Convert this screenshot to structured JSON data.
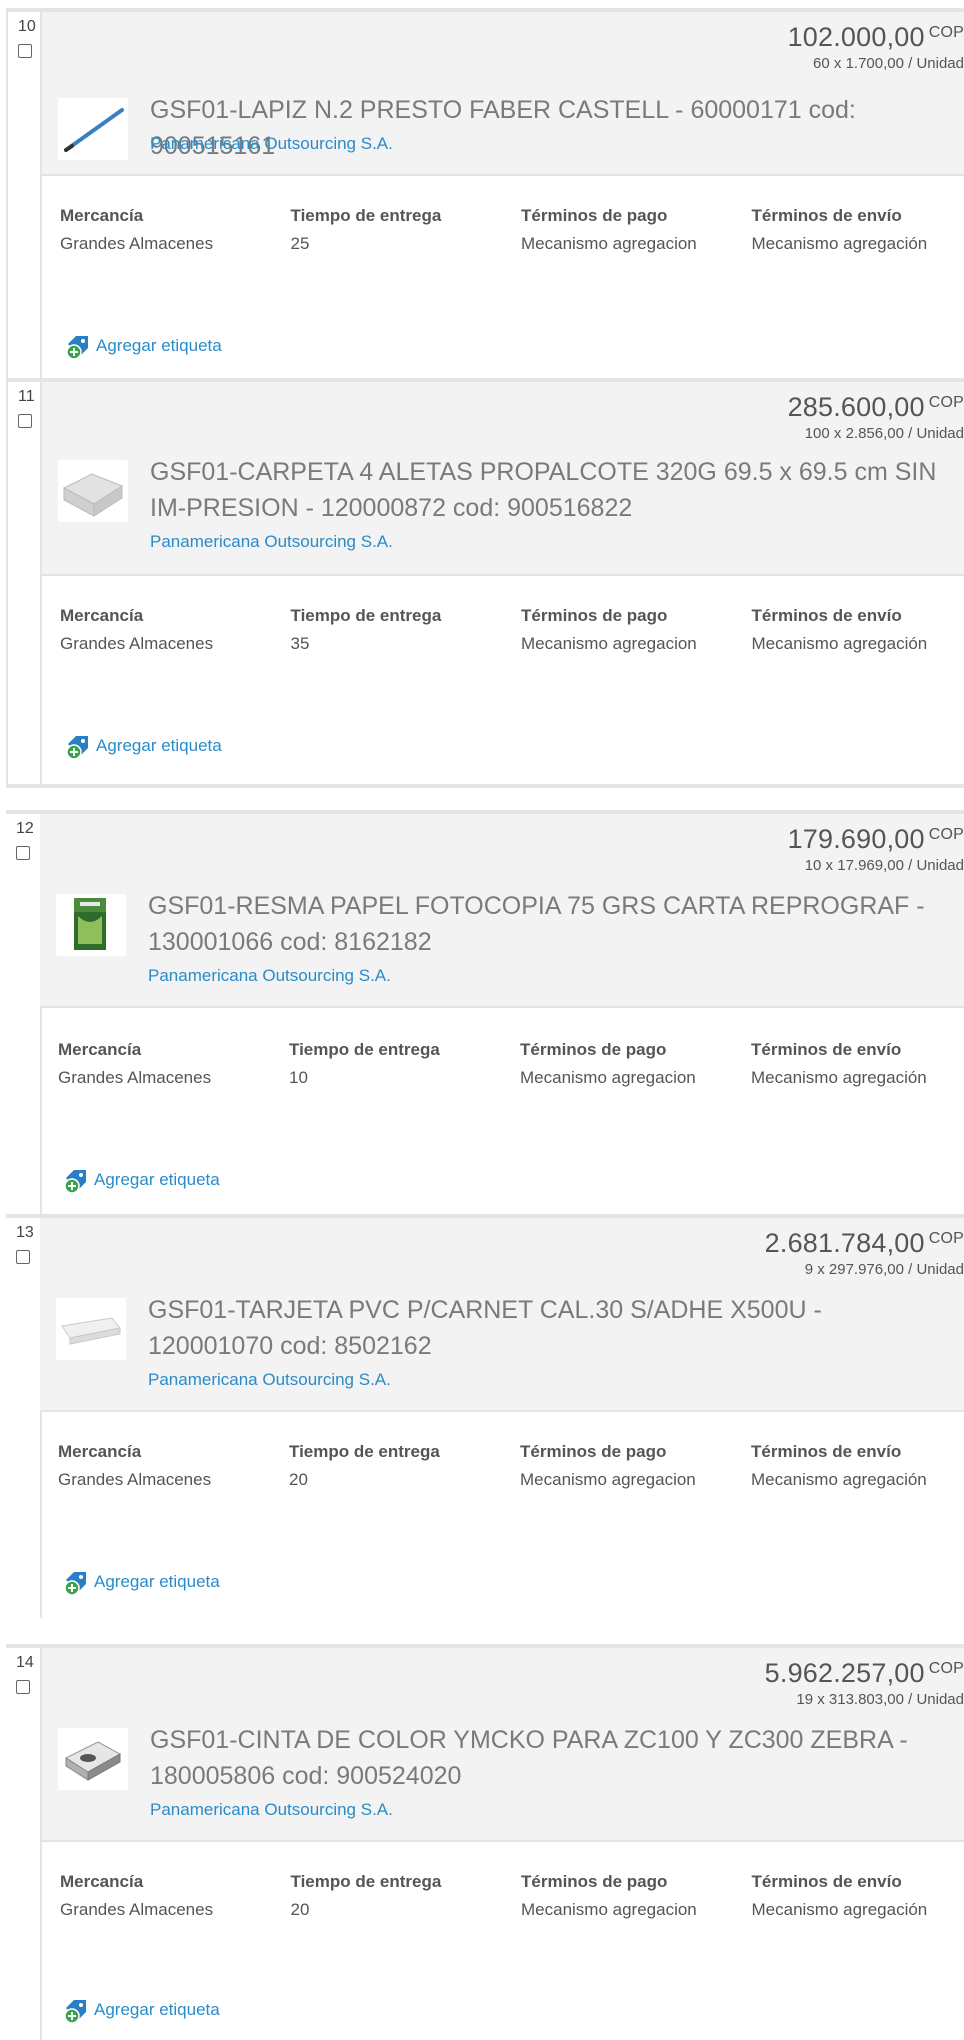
{
  "labels": {
    "merchandise": "Mercancía",
    "delivery": "Tiempo de entrega",
    "payment": "Términos de pago",
    "shipping": "Términos de envío",
    "add_tag": "Agregar etiqueta"
  },
  "items": [
    {
      "index": "10",
      "price": "102.000,00",
      "currency": "COP",
      "unit_line": "60 x 1.700,00 / Unidad",
      "title": "GSF01-LAPIZ N.2 PRESTO FABER CASTELL - 60000171 cod: 900515161",
      "vendor": "Panamericana Outsourcing S.A.",
      "merchandise": "Grandes Almacenes",
      "delivery": "25",
      "payment": "Mecanismo agregacion",
      "shipping": "Mecanismo agregación",
      "icon": "pencil-icon"
    },
    {
      "index": "11",
      "price": "285.600,00",
      "currency": "COP",
      "unit_line": "100 x 2.856,00 / Unidad",
      "title": "GSF01-CARPETA 4 ALETAS PROPALCOTE 320G 69.5 x 69.5 cm SIN IM-PRESION - 120000872 cod: 900516822",
      "vendor": "Panamericana Outsourcing S.A.",
      "merchandise": "Grandes Almacenes",
      "delivery": "35",
      "payment": "Mecanismo agregacion",
      "shipping": "Mecanismo agregación",
      "icon": "folder-icon"
    },
    {
      "index": "12",
      "price": "179.690,00",
      "currency": "COP",
      "unit_line": "10 x 17.969,00 / Unidad",
      "title": "GSF01-RESMA PAPEL FOTOCOPIA 75 GRS CARTA REPROGRAF - 130001066 cod: 8162182",
      "vendor": "Panamericana Outsourcing S.A.",
      "merchandise": "Grandes Almacenes",
      "delivery": "10",
      "payment": "Mecanismo agregacion",
      "shipping": "Mecanismo agregación",
      "icon": "paper-ream-icon"
    },
    {
      "index": "13",
      "price": "2.681.784,00",
      "currency": "COP",
      "unit_line": "9 x 297.976,00 / Unidad",
      "title": "GSF01-TARJETA PVC P/CARNET CAL.30 S/ADHE X500U - 120001070 cod: 8502162",
      "vendor": "Panamericana Outsourcing S.A.",
      "merchandise": "Grandes Almacenes",
      "delivery": "20",
      "payment": "Mecanismo agregacion",
      "shipping": "Mecanismo agregación",
      "icon": "card-pack-icon"
    },
    {
      "index": "14",
      "price": "5.962.257,00",
      "currency": "COP",
      "unit_line": "19 x 313.803,00 / Unidad",
      "title": "GSF01-CINTA DE COLOR YMCKO PARA ZC100 Y ZC300 ZEBRA - 180005806 cod: 900524020",
      "vendor": "Panamericana Outsourcing S.A.",
      "merchandise": "Grandes Almacenes",
      "delivery": "20",
      "payment": "Mecanismo agregacion",
      "shipping": "Mecanismo agregación",
      "icon": "ribbon-cartridge-icon"
    }
  ]
}
